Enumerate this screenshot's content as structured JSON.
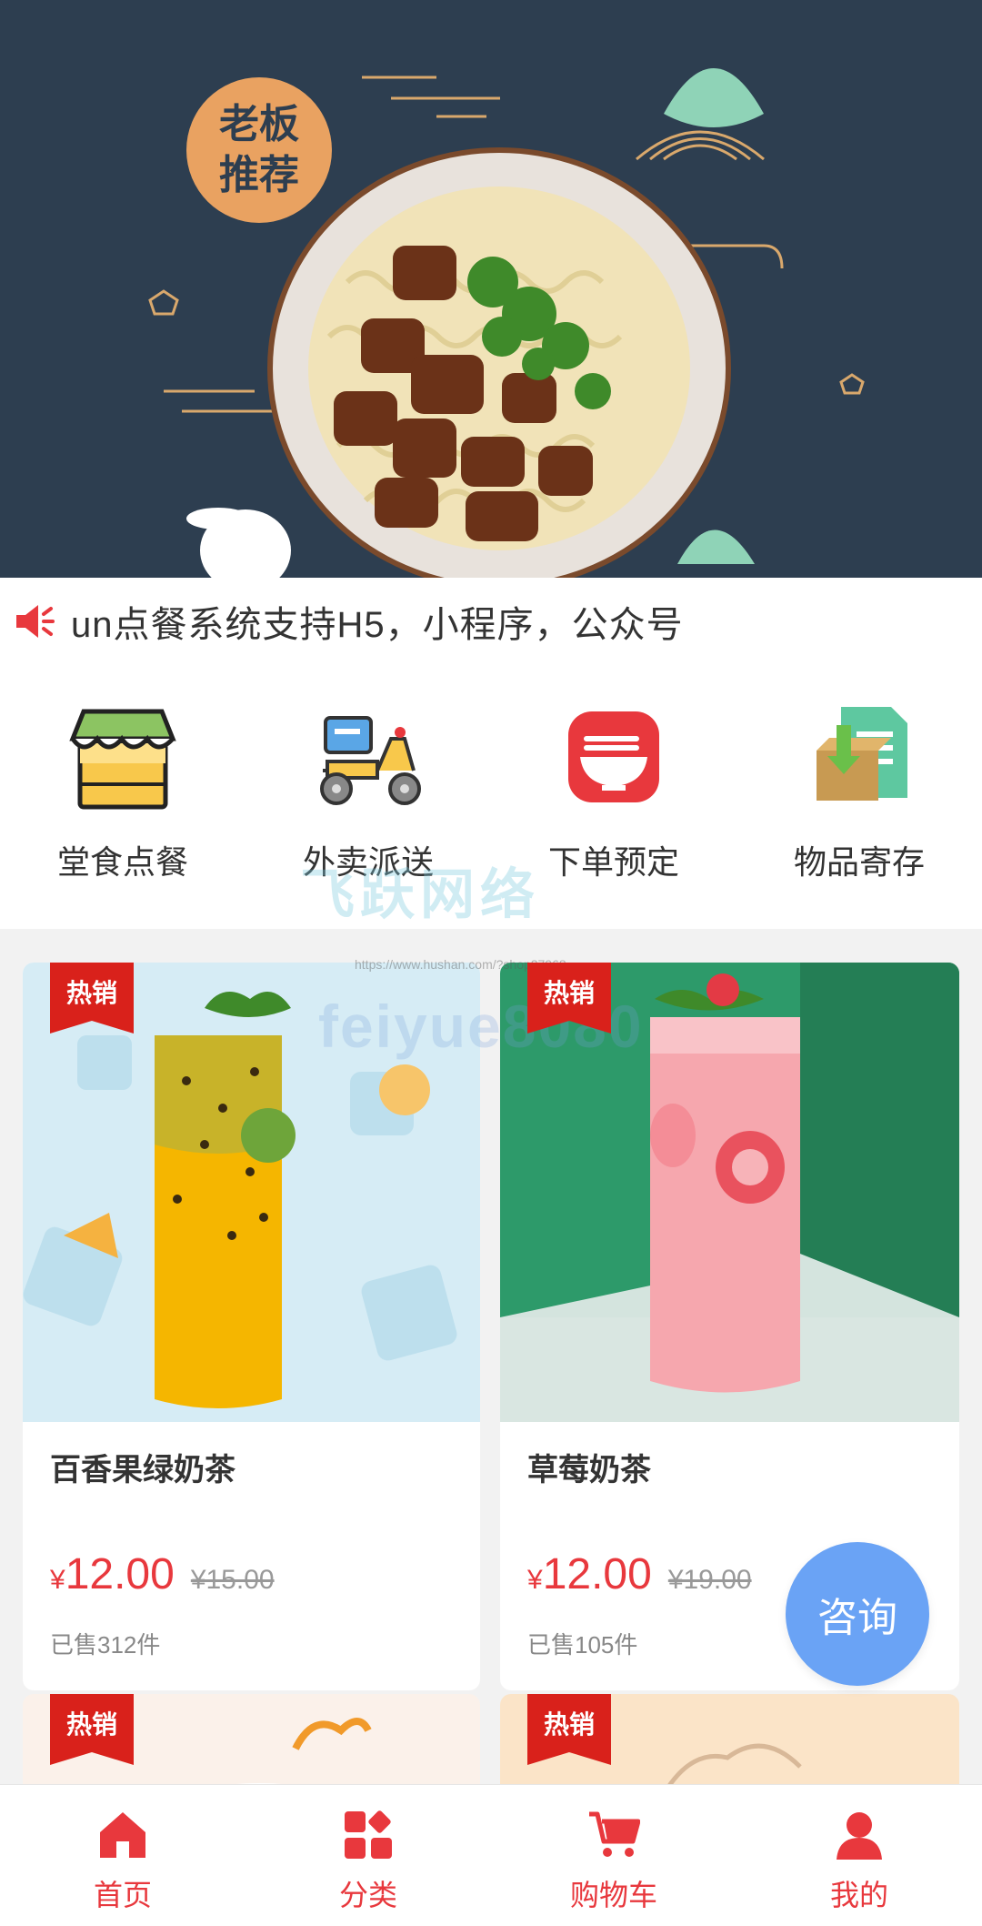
{
  "banner": {
    "badge_line1": "老板",
    "badge_line2": "推荐"
  },
  "notice": {
    "icon": "speaker-icon",
    "text": "un点餐系统支持H5，小程序，公众号"
  },
  "nav": [
    {
      "label": "堂食点餐",
      "icon": "shop-icon"
    },
    {
      "label": "外卖派送",
      "icon": "scooter-icon"
    },
    {
      "label": "下单预定",
      "icon": "bowl-icon"
    },
    {
      "label": "物品寄存",
      "icon": "storage-box-icon"
    }
  ],
  "watermark": {
    "line1": "飞跃网络",
    "url": "https://www.hushan.com/?shop27968",
    "line2": "feiyue8080"
  },
  "products": [
    {
      "tag": "热销",
      "name": "百香果绿奶茶",
      "currency": "¥",
      "price": "12.00",
      "old_price": "¥15.00",
      "sold": "已售312件"
    },
    {
      "tag": "热销",
      "name": "草莓奶茶",
      "currency": "¥",
      "price": "12.00",
      "old_price": "¥19.00",
      "sold": "已售105件"
    },
    {
      "tag": "热销"
    },
    {
      "tag": "热销"
    }
  ],
  "consult": {
    "label": "咨询"
  },
  "tabbar": [
    {
      "label": "首页",
      "icon": "home-icon"
    },
    {
      "label": "分类",
      "icon": "category-icon"
    },
    {
      "label": "购物车",
      "icon": "cart-icon"
    },
    {
      "label": "我的",
      "icon": "user-icon"
    }
  ],
  "colors": {
    "accent": "#e8383d",
    "banner_bg": "#2d3e50",
    "consult": "#6aa3f5"
  }
}
